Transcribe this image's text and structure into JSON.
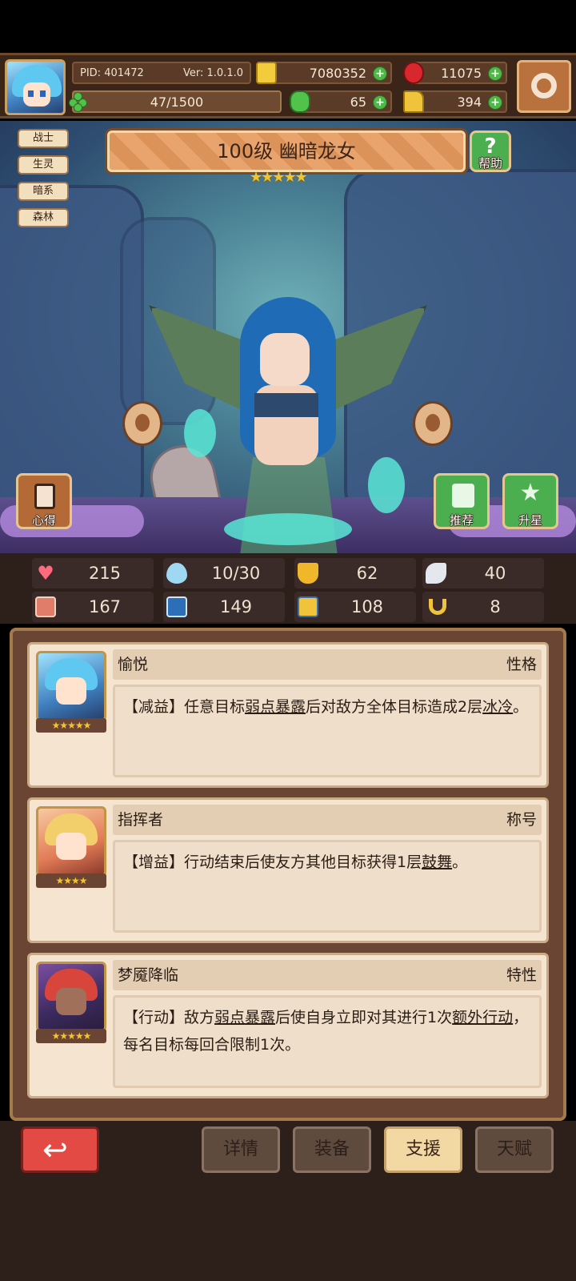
{
  "header": {
    "pid": "PID: 401472",
    "version": "Ver: 1.0.1.0",
    "energy": {
      "text": "47/1500",
      "fraction": 0.031
    },
    "gold": "7080352",
    "rubies": "11075",
    "clovers": "65",
    "boots": "394"
  },
  "hero": {
    "tags": [
      "战士",
      "生灵",
      "暗系",
      "森林"
    ],
    "title": "100级 幽暗龙女",
    "stars": "★★★★★",
    "help_label": "帮助",
    "insight_label": "心得",
    "recommend_label": "推荐",
    "star_up_label": "升星"
  },
  "stats": {
    "hp": "215",
    "mana": "10/30",
    "defense": "62",
    "speed": "40",
    "attack": "167",
    "magic": "149",
    "agility": "108",
    "luck": "8"
  },
  "support": [
    {
      "name": "愉悦",
      "kind": "性格",
      "stars": "★★★★★",
      "desc_parts": [
        "【减益】任意目标",
        "弱点暴露",
        "后对敌方全体目标造成2层",
        "冰冷",
        "。"
      ]
    },
    {
      "name": "指挥者",
      "kind": "称号",
      "stars": "★★★★",
      "desc_parts": [
        "【增益】行动结束后使友方其他目标获得1层",
        "鼓舞",
        "。"
      ]
    },
    {
      "name": "梦魇降临",
      "kind": "特性",
      "stars": "★★★★★",
      "desc_parts": [
        "【行动】敌方",
        "弱点暴露",
        "后使自身立即对其进行1次",
        "额外行动",
        "，每名目标每回合限制1次。"
      ]
    }
  ],
  "nav": {
    "details": "详情",
    "equipment": "装备",
    "support": "支援",
    "talent": "天赋"
  },
  "colors": {
    "accent_green": "#4caf4f",
    "back_red": "#e24a43",
    "panel_brown": "#6a4534",
    "active_tab": "#f2d9a4"
  }
}
